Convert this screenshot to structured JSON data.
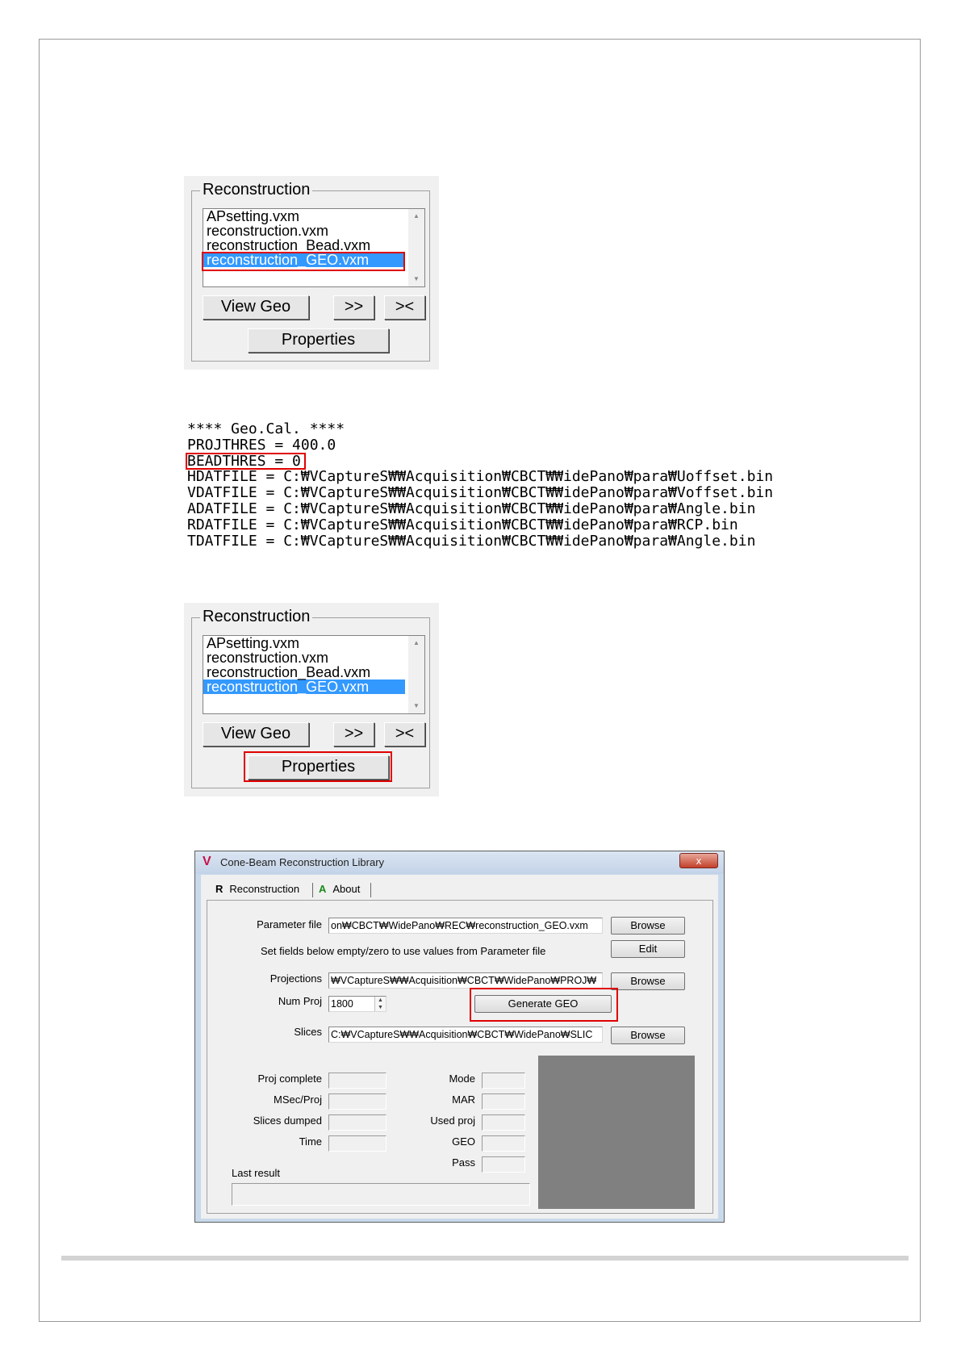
{
  "panel1": {
    "legend": "Reconstruction",
    "files": [
      "APsetting.vxm",
      "reconstruction.vxm",
      "reconstruction_Bead.vxm",
      "reconstruction_GEO.vxm"
    ],
    "selected_index": 3,
    "view_geo": "View Geo",
    "next": ">>",
    "collapse": "><",
    "properties": "Properties"
  },
  "geo_cal": {
    "lines": [
      "**** Geo.Cal. ****",
      "PROJTHRES = 400.0",
      "BEADTHRES = 0",
      "HDATFILE = C:₩VCaptureS₩₩Acquisition₩CBCT₩₩idePano₩para₩Uoffset.bin",
      "VDATFILE = C:₩VCaptureS₩₩Acquisition₩CBCT₩₩idePano₩para₩Voffset.bin",
      "ADATFILE = C:₩VCaptureS₩₩Acquisition₩CBCT₩₩idePano₩para₩Angle.bin",
      "RDATFILE = C:₩VCaptureS₩₩Acquisition₩CBCT₩₩idePano₩para₩RCP.bin",
      "TDATFILE = C:₩VCaptureS₩₩Acquisition₩CBCT₩₩idePano₩para₩Angle.bin"
    ]
  },
  "panel2": {
    "legend": "Reconstruction",
    "files": [
      "APsetting.vxm",
      "reconstruction.vxm",
      "reconstruction_Bead.vxm",
      "reconstruction_GEO.vxm"
    ],
    "selected_index": 3,
    "view_geo": "View Geo",
    "next": ">>",
    "collapse": "><",
    "properties": "Properties"
  },
  "dialog": {
    "logo": "V",
    "title": "Cone-Beam Reconstruction Library",
    "close": "x",
    "tabs": [
      {
        "letter": "R",
        "label": "Reconstruction"
      },
      {
        "letter": "A",
        "label": "About"
      }
    ],
    "parameter_file_label": "Parameter file",
    "parameter_file_value": "on₩CBCT₩WidePano₩REC₩reconstruction_GEO.vxm",
    "browse": "Browse",
    "edit": "Edit",
    "hint": "Set fields below empty/zero to use values from Parameter file",
    "projections_label": "Projections",
    "projections_value": "₩VCaptureS₩₩Acquisition₩CBCT₩WidePano₩PROJ₩",
    "num_proj_label": "Num Proj",
    "num_proj_value": "1800",
    "generate_geo": "Generate GEO",
    "slices_label": "Slices",
    "slices_value": "C:₩VCaptureS₩₩Acquisition₩CBCT₩WidePano₩SLIC",
    "stats_left": [
      "Proj complete",
      "MSec/Proj",
      "Slices dumped",
      "Time"
    ],
    "stats_right": [
      "Mode",
      "MAR",
      "Used proj",
      "GEO",
      "Pass"
    ],
    "last_result_label": "Last result",
    "colors": {
      "titlebar": "#c3d3e8",
      "close": "#c3402a",
      "preview": "#808080",
      "selection": "#3399ff",
      "highlight": "#e00000"
    }
  }
}
